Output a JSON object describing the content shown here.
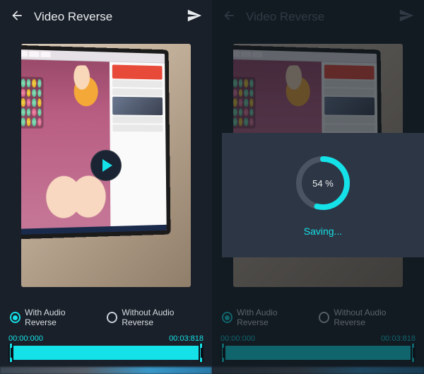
{
  "accent": "#14e1e8",
  "left": {
    "header": {
      "title": "Video Reverse"
    },
    "options": {
      "with_audio": "With Audio Reverse",
      "without_audio": "Without Audio  Reverse",
      "selected": "with_audio"
    },
    "time": {
      "start": "00:00:000",
      "end": "00:03:818"
    }
  },
  "right": {
    "header": {
      "title": "Video Reverse"
    },
    "options": {
      "with_audio": "With Audio Reverse",
      "without_audio": "Without Audio  Reverse",
      "selected": "with_audio"
    },
    "time": {
      "start": "00:00:000",
      "end": "00:03:818"
    },
    "progress": {
      "percent": 54,
      "label": "54 %",
      "status": "Saving..."
    }
  }
}
